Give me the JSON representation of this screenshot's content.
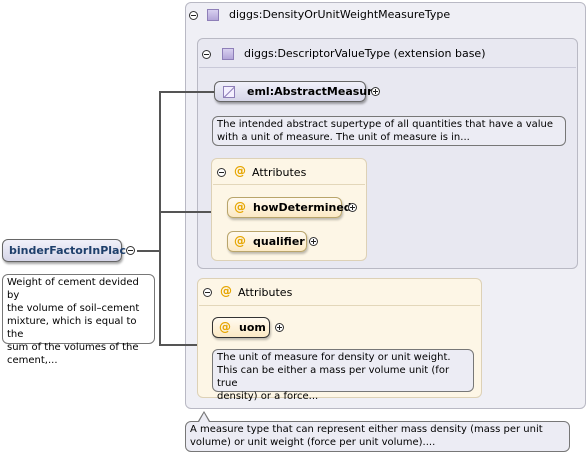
{
  "root": {
    "name": "binderFactorInPlace",
    "doc": [
      "Weight of cement devided by",
      "the volume of soil–cement",
      "mixture, which is equal to the",
      "sum of the volumes of the",
      "cement,..."
    ]
  },
  "outer_type": {
    "label": "diggs:DensityOrUnitWeightMeasureType",
    "doc": [
      "A measure type that can represent either mass density (mass per unit",
      "volume) or unit weight (force per unit volume)...."
    ]
  },
  "base_type": {
    "label": "diggs:DescriptorValueType (extension base)"
  },
  "abstract_measure": {
    "name": "eml:AbstractMeasure",
    "doc": [
      "The intended abstract supertype of all quantities that have a value",
      "with a unit of measure. The unit of measure is in..."
    ]
  },
  "base_attributes": {
    "heading": "Attributes",
    "items": [
      "howDetermined",
      "qualifier"
    ]
  },
  "ext_attributes": {
    "heading": "Attributes",
    "items": [
      "uom"
    ],
    "uom_doc": [
      "The unit of measure for density or unit weight.",
      "This can be either a mass per volume unit (for true",
      "density) or a force..."
    ]
  },
  "colors": {
    "type_pane": "#efeff5",
    "attr_pane": "#fdf6e6",
    "element_box": "#d5d5e8",
    "attr_icon": "#e6a500"
  }
}
